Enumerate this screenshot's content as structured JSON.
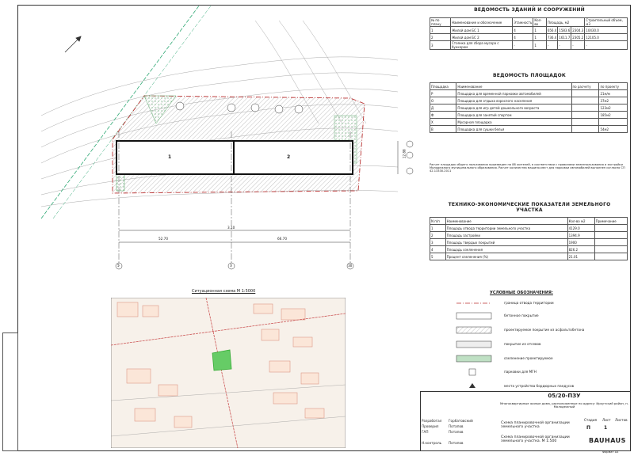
{
  "doc": {
    "code": "05/20-ПЗУ",
    "description": "Многоквартирные жилые дома, расположенные по адресу: Иркутский район, п. Молодежный",
    "sheet_title_1": "Схема планировочной организации земельного участка",
    "sheet_title_2": "Схема планировочной организации земельного участка. М 1:500",
    "stage_label": "Стадия",
    "sheet_label": "Лист",
    "sheets_label": "Листов",
    "stage": "П",
    "sheet": "1",
    "company": "BAUHAUS",
    "format": "Формат А3"
  },
  "buildings": {
    "title": "ВЕДОМОСТЬ ЗДАНИЙ И СООРУЖЕНИЙ",
    "headers": [
      "№ по плану",
      "Наименование и обозначение",
      "Этажность",
      "Кол-во",
      "Площадь, м2",
      "Строительный объем, м3"
    ],
    "rows": [
      [
        "1",
        "Жилой дом БС 1",
        "4",
        "1",
        "656.4",
        "1583.6",
        "2304.3",
        "10430.0"
      ],
      [
        "2",
        "Жилой дом БС 2",
        "4",
        "1",
        "736.4",
        "1611.7",
        "2305.2",
        "12105.0"
      ],
      [
        "3",
        "Стоянка для сбора мусора с бункером",
        "-",
        "1",
        "-",
        "-",
        "-",
        "-"
      ]
    ]
  },
  "sites": {
    "title": "ВЕДОМОСТЬ ПЛОЩАДОК",
    "headers": [
      "Площадка",
      "Наименование",
      "по расчету",
      "по проекту"
    ],
    "rows": [
      [
        "Р",
        "Площадка для временной парковки автомобилей",
        "",
        "21м/м"
      ],
      [
        "О",
        "Площадка для отдыха взрослого населения",
        "",
        "37м2"
      ],
      [
        "Д",
        "Площадка для игр детей дошкольного возраста",
        "",
        "123м2"
      ],
      [
        "Ф",
        "Площадка для занятий спортом",
        "",
        "185м2"
      ],
      [
        "Х",
        "Мусорная площадка",
        "",
        ""
      ],
      [
        "В",
        "Площадка для сушки белья",
        "",
        "54м2"
      ]
    ],
    "note": "Расчет площадок общего пользования произведен на 88 жителей, в соответствии с правилами землепользования и застройки Молодежного муниципального образования. Расчет количества машино-мест для парковки автомобилей выполнен согласно СП 42.13330.2011"
  },
  "tep": {
    "title": "ТЕХНИКО-ЭКОНОМИЧЕСКИЕ ПОКАЗАТЕЛИ ЗЕМЕЛЬНОГО УЧАСТКА",
    "headers": [
      "N п/п",
      "Наименование",
      "Кол-во м2",
      "Примечание"
    ],
    "rows": [
      [
        "1",
        "Площадь отвода территории земельного участка",
        "4129.0",
        ""
      ],
      [
        "2",
        "Площадь застройки",
        "1394.9",
        ""
      ],
      [
        "3",
        "Площадь твердых покрытий",
        "1900",
        ""
      ],
      [
        "4",
        "Площадь озеленения",
        "826.2",
        ""
      ],
      [
        "5",
        "Процент озеленения (%)",
        "21.01",
        ""
      ]
    ]
  },
  "legend": {
    "title": "УСЛОВНЫЕ ОБОЗНАЧЕНИЯ:",
    "items": [
      "граница отвода территории",
      "бетонное покрытие",
      "проектируемое покрытие из асфальтобетона",
      "покрытие из отсевов",
      "озеленение проектируемое",
      "парковки для МГН",
      "места устройства бордюрных пандусов"
    ]
  },
  "situation": {
    "title": "Ситуационная схема М 1:5000"
  },
  "plan": {
    "building1": "1",
    "building2": "2",
    "dim1": "52.70",
    "dim2": "66.70",
    "dim3": "3.10",
    "side_dim": "12.88",
    "mark1": "5",
    "mark2": "1",
    "mark3": "10"
  },
  "stamp_rows": [
    [
      "Разработал",
      "Горбатовский"
    ],
    [
      "Проверил",
      "Потапов"
    ],
    [
      "ГАП",
      "Потапов"
    ],
    [
      "Н.контроль",
      "Потапов"
    ]
  ],
  "colors": {
    "line": "#333333",
    "green": "#5aa86a",
    "hatch": "#777777"
  }
}
